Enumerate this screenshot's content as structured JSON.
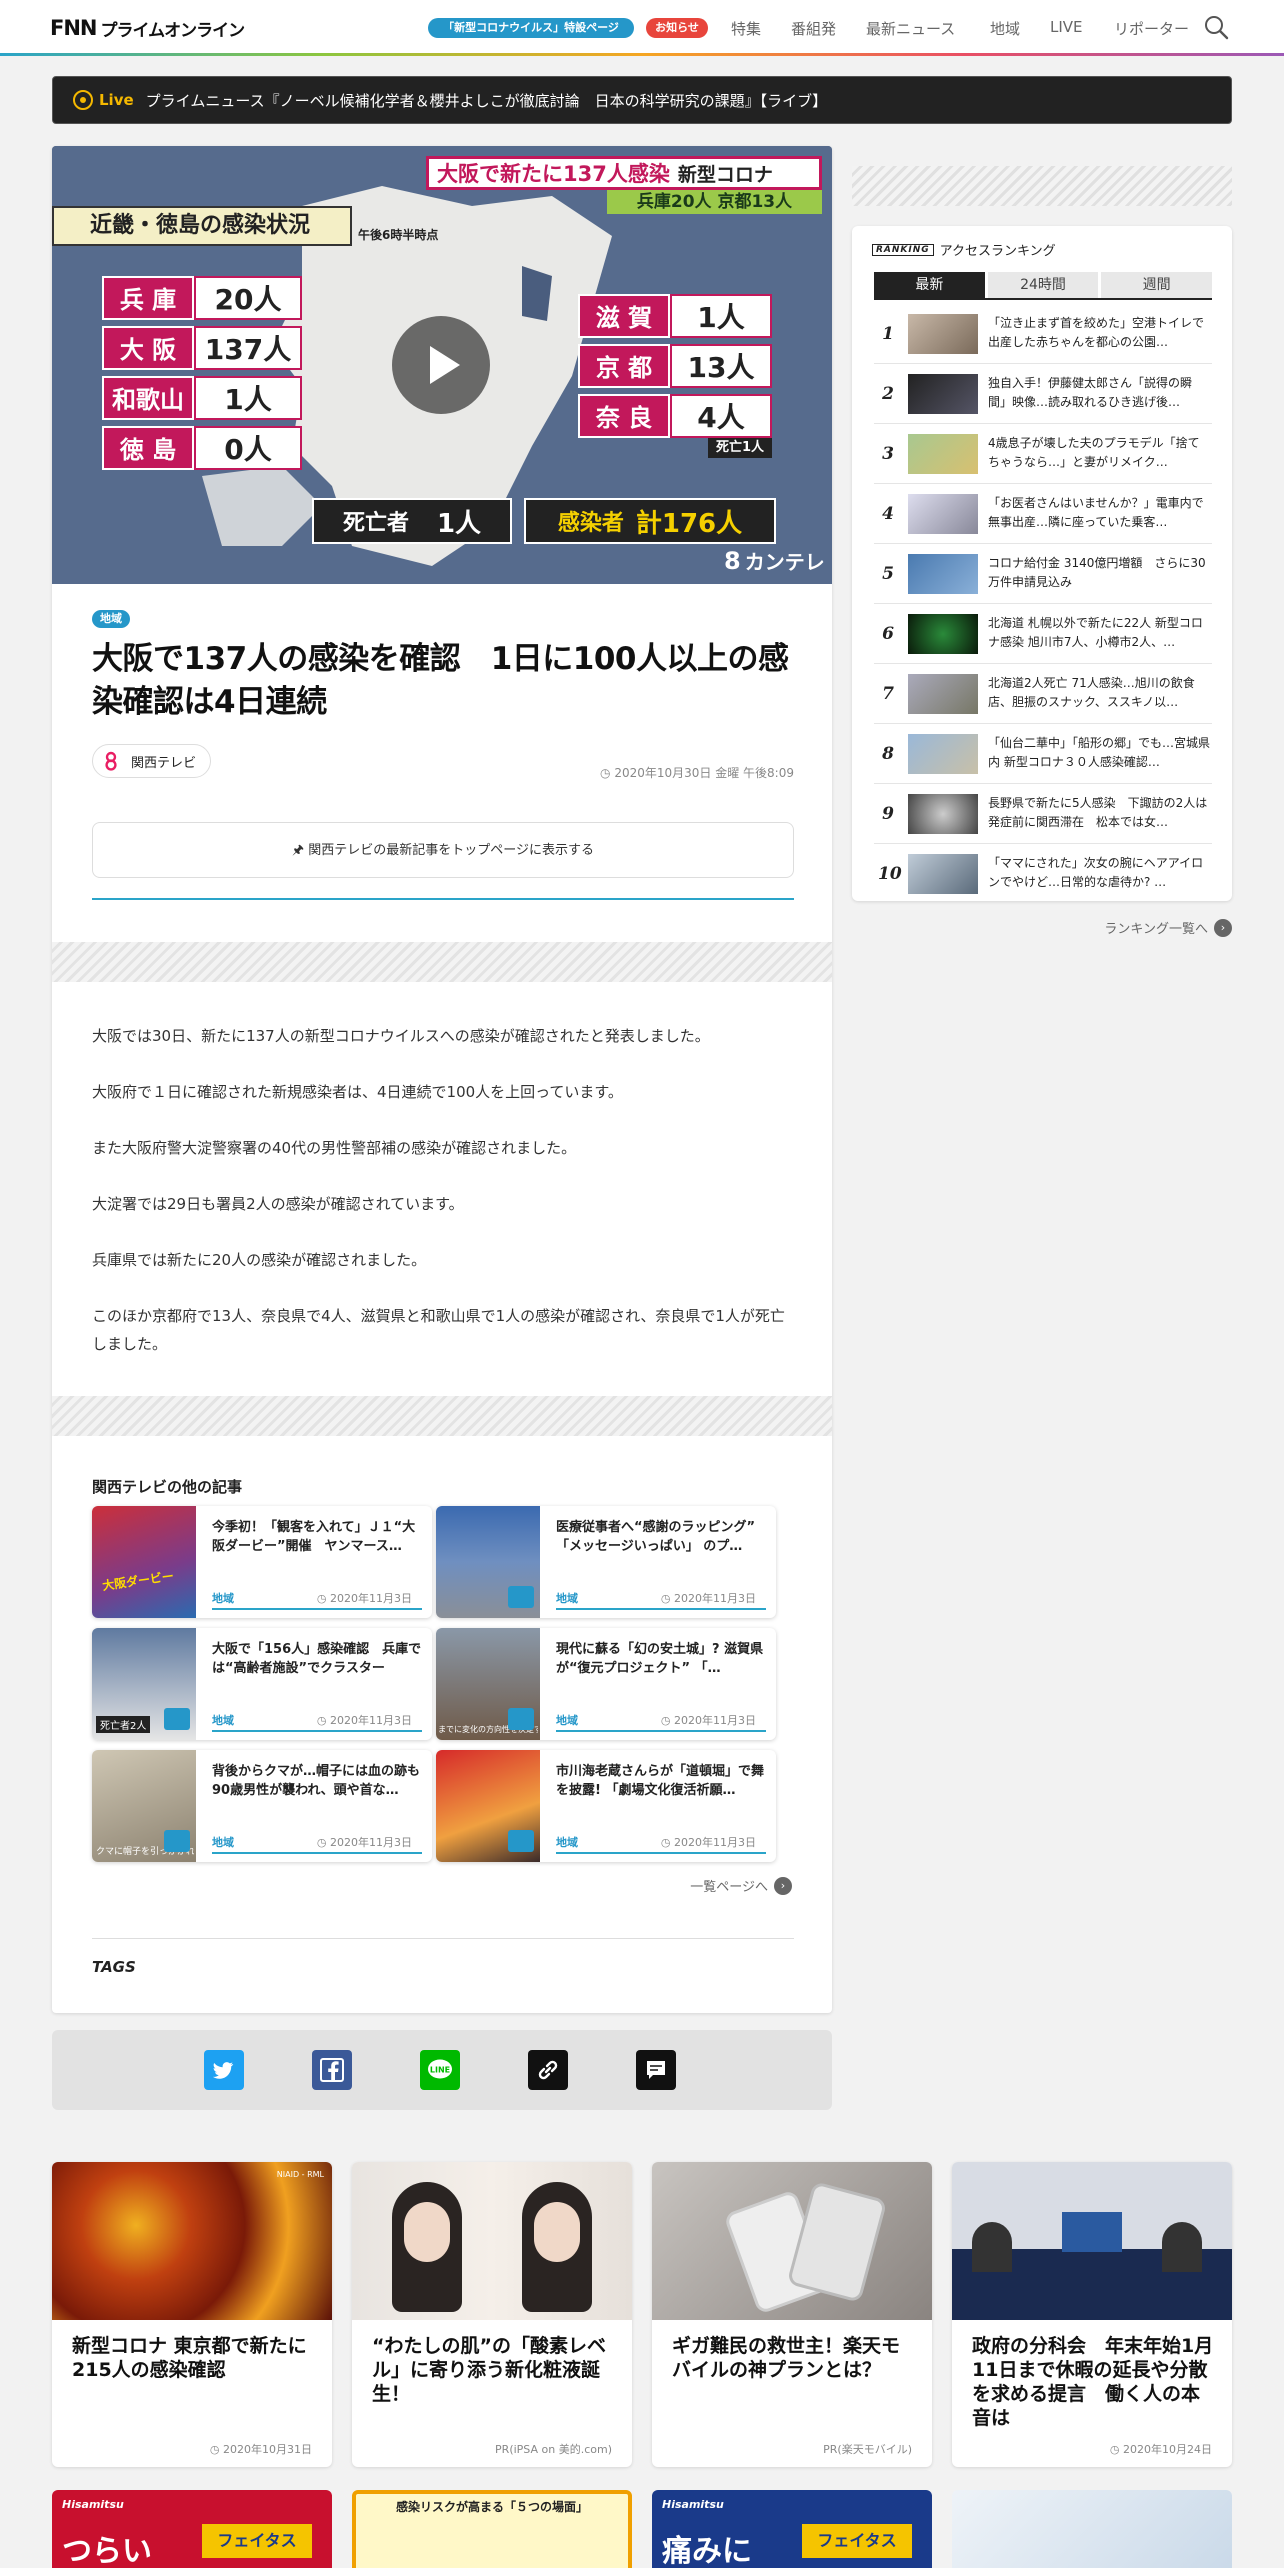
{
  "header": {
    "logo_mark": "FNN",
    "logo_text": "プライムオンライン",
    "covid_pill": "「新型コロナウイルス」特設ページ",
    "notice_pill": "お知らせ",
    "nav": [
      "特集",
      "番組発",
      "最新ニュース",
      "地域",
      "LIVE",
      "リポーター"
    ]
  },
  "live": {
    "label": "Live",
    "text": "プライムニュース『ノーベル候補化学者＆櫻井よしこが徹底討論　日本の科学研究の課題』【ライブ】"
  },
  "hero": {
    "headline": "大阪で新たに137人感染",
    "headline2": "新型コロナ",
    "sub": "兵庫20人 京都13人",
    "box_title": "近畿・徳島の感染状況",
    "time_note": "午後6時半時点",
    "left_prefs": [
      {
        "name": "兵 庫",
        "count": "20人"
      },
      {
        "name": "大 阪",
        "count": "137人"
      },
      {
        "name": "和歌山",
        "count": "1人"
      },
      {
        "name": "徳 島",
        "count": "0人"
      }
    ],
    "right_prefs": [
      {
        "name": "滋 賀",
        "count": "1人"
      },
      {
        "name": "京 都",
        "count": "13人"
      },
      {
        "name": "奈 良",
        "count": "4人"
      }
    ],
    "nara_death": "死亡1人",
    "deaths_label": "死亡者",
    "deaths_value": "1人",
    "total_label": "感染者",
    "total_value": "計176人",
    "broadcaster": "カンテレ"
  },
  "article": {
    "category": "地域",
    "title": "大阪で137人の感染を確認　1日に100人以上の感染確認は4日連続",
    "source": "関西テレビ",
    "date": "2020年10月30日 金曜 午後8:09",
    "pin_button": "関西テレビの最新記事をトップページに表示する",
    "paragraphs": [
      "大阪では30日、新たに137人の新型コロナウイルスへの感染が確認されたと発表しました。",
      "大阪府で１日に確認された新規感染者は、4日連続で100人を上回っています。",
      "また大阪府警大淀警察署の40代の男性警部補の感染が確認されました。",
      "大淀署では29日も署員2人の感染が確認されています。",
      "兵庫県では新たに20人の感染が確認されました。",
      "このほか京都府で13人、奈良県で4人、滋賀県と和歌山県で1人の感染が確認され、奈良県で1人が死亡しました。"
    ],
    "others_heading": "関西テレビの他の記事",
    "others": [
      {
        "title": "今季初！「観客を入れて」Ｊ１“大阪ダービー”開催　ヤンマース…",
        "category": "地域",
        "date": "2020年11月3日"
      },
      {
        "title": "医療従事者へ“感謝のラッピング” 「メッセージいっぱい」 のプ…",
        "category": "地域",
        "date": "2020年11月3日"
      },
      {
        "title": "大阪で「156人」感染確認　兵庫では“高齢者施設”でクラスター",
        "category": "地域",
        "date": "2020年11月3日"
      },
      {
        "title": "現代に蘇る「幻の安土城」? 滋賀県が“復元プロジェクト” 「…",
        "category": "地域",
        "date": "2020年11月3日"
      },
      {
        "title": "背後からクマが…帽子には血の跡も　90歳男性が襲われ、頭や首な…",
        "category": "地域",
        "date": "2020年11月3日"
      },
      {
        "title": "市川海老蔵さんらが「道頓堀」で舞を披露! 「劇場文化復活祈願…",
        "category": "地域",
        "date": "2020年11月3日"
      }
    ],
    "list_link": "一覧ページへ",
    "tags_label": "TAGS"
  },
  "share": [
    "twitter-icon",
    "facebook-icon",
    "line-icon",
    "link-icon",
    "comment-icon"
  ],
  "ranking": {
    "badge": "RANKING",
    "title": "アクセスランキング",
    "tabs": [
      "最新",
      "24時間",
      "週間"
    ],
    "items": [
      "「泣き止まず首を絞めた」空港トイレで出産した赤ちゃんを都心の公園…",
      "独自入手！伊藤健太郎さん「説得の瞬間」映像…読み取れるひき逃げ後…",
      "4歳息子が壊した夫のプラモデル「捨てちゃうなら…」と妻がリメイク…",
      "「お医者さんはいませんか？」電車内で無事出産…隣に座っていた乗客…",
      "コロナ給付金 3140億円増額　さらに30万件申請見込み",
      "北海道 札幌以外で新たに22人 新型コロナ感染 旭川市7人、小樽市2人、…",
      "北海道2人死亡 71人感染…旭川の飲食店、胆振のスナック、ススキノ以…",
      "「仙台二華中」「船形の郷」でも…宮城県内 新型コロナ３０人感染確認…",
      "長野県で新たに5人感染　下諏訪の2人は発症前に関西滞在　松本では女…",
      "「ママにされた」次女の腕にヘアアイロンでやけど…日常的な虐待か? …"
    ],
    "more": "ランキング一覧へ"
  },
  "bottom_cards": [
    {
      "title": "新型コロナ 東京都で新たに215人の感染確認",
      "meta": "2020年10月31日"
    },
    {
      "title": "“わたしの肌”の「酸素レベル」に寄り添う新化粧液誕生！",
      "meta": "PR(iPSA on 美的.com)"
    },
    {
      "title": "ギガ難民の救世主！楽天モバイルの神プランとは？",
      "meta": "PR(楽天モバイル)"
    },
    {
      "title": "政府の分科会　年末年始1月11日まで休暇の延長や分散を求める提言　働く人の本音は",
      "meta": "2020年10月24日"
    }
  ],
  "bottom_row2": [
    {
      "brand": "Hisamitsu",
      "text": "つらい",
      "product": "フェイタス"
    },
    {
      "text": "感染リスクが高まる「５つの場面」"
    },
    {
      "brand": "Hisamitsu",
      "text": "痛みに",
      "product": "フェイタス"
    },
    {}
  ],
  "image_captions": {
    "kumo": "クマに帽子を引っかかれた",
    "osaka_derby": "大阪ダービー",
    "dead_badge": "死亡者2人",
    "ipsa": "NIAID - RML",
    "azuchi": "までに変化の方向性を決定する"
  }
}
